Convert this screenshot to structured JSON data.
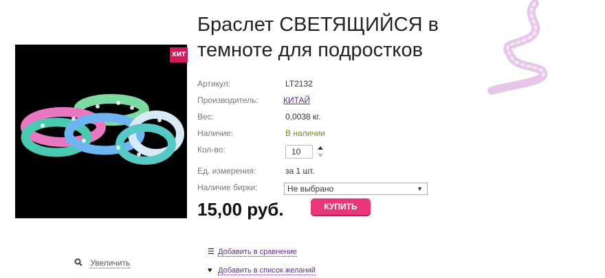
{
  "product": {
    "title_line1": "Браслет СВЕТЯЩИЙСЯ в",
    "title_line2": "темноте для подростков",
    "badge": "ХИТ",
    "zoom_label": "Увеличить"
  },
  "specs": {
    "article_label": "Артикул:",
    "article_value": "LT2132",
    "maker_label": "Производитель:",
    "maker_value": "КИТАЙ",
    "weight_label": "Вес:",
    "weight_value": "0,0038 кг.",
    "stock_label": "Наличие:",
    "stock_value": "В наличии",
    "qty_label": "Кол-во:",
    "qty_value": "10",
    "unit_label": "Ед. измерения:",
    "unit_value": "за 1 шт.",
    "tag_label": "Наличие бирки:",
    "tag_value": "Не выбрано"
  },
  "price": "15,00 руб.",
  "buy_label": "КУПИТЬ",
  "actions": {
    "compare": "Добавить в сравнение",
    "wishlist": "Добавить в список желаний"
  },
  "colors": {
    "accent": "#e9387a",
    "badge": "#d01a5c",
    "link": "#5a2d82",
    "in_stock": "#6e8b1f"
  },
  "icons": [
    "search-icon",
    "list-icon",
    "heart-icon",
    "ribbon-decoration",
    "caret-down-icon",
    "spinner-arrows-icon"
  ]
}
